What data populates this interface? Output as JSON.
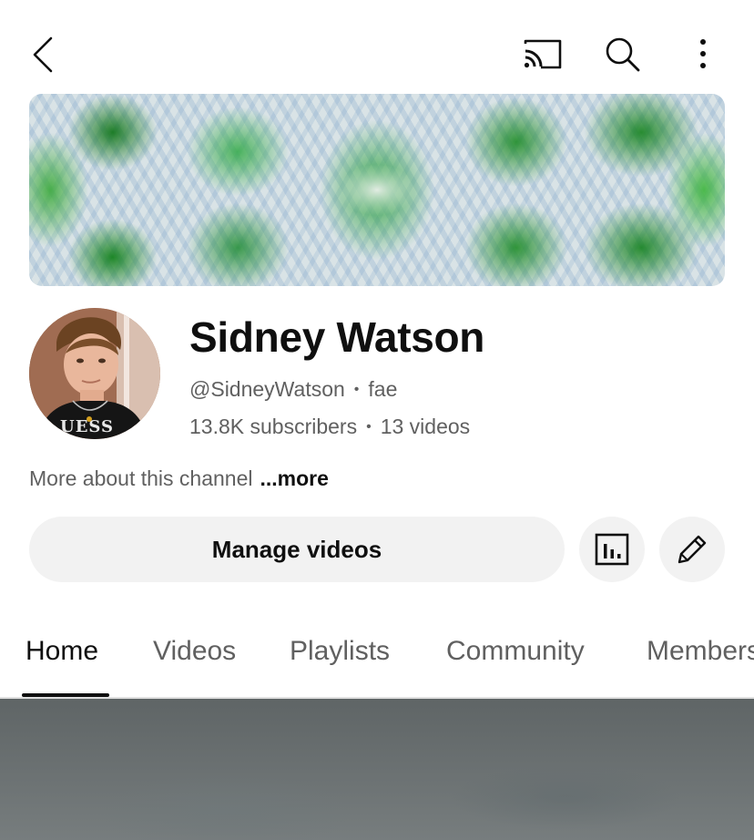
{
  "topbar": {
    "icons": [
      "back-icon",
      "cast-icon",
      "search-icon",
      "more-vertical-icon"
    ]
  },
  "channel": {
    "name": "Sidney Watson",
    "handle": "@SidneyWatson",
    "pronouns": "fae",
    "subscribers": "13.8K subscribers",
    "videos": "13 videos",
    "about_text": "More about this channel",
    "about_more": "...more",
    "avatar_shirt_text": "UESS"
  },
  "actions": {
    "manage_label": "Manage videos",
    "icons": [
      "analytics-icon",
      "edit-pencil-icon"
    ]
  },
  "tabs": [
    {
      "label": "Home",
      "active": true
    },
    {
      "label": "Videos",
      "active": false
    },
    {
      "label": "Playlists",
      "active": false
    },
    {
      "label": "Community",
      "active": false
    },
    {
      "label": "Members",
      "active": false
    }
  ],
  "colors": {
    "text_primary": "#0f0f0f",
    "text_secondary": "#606060",
    "button_bg": "#f2f2f2",
    "banner_green": "#2fa040"
  }
}
